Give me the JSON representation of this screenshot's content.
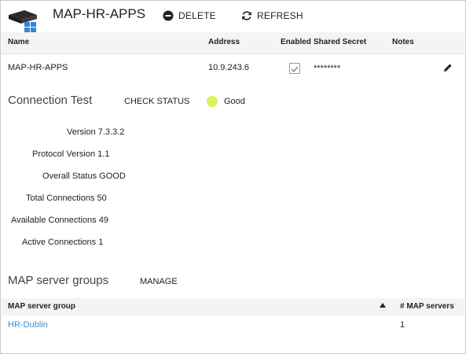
{
  "header": {
    "title": "MAP-HR-APPS",
    "delete_label": "DELETE",
    "refresh_label": "REFRESH",
    "app_icon": "server-windows-icon"
  },
  "table": {
    "columns": [
      "Name",
      "Address",
      "Enabled",
      "Shared Secret",
      "Notes"
    ],
    "row": {
      "name": "MAP-HR-APPS",
      "address": "10.9.243.6",
      "enabled": true,
      "shared_secret": "********",
      "notes": ""
    }
  },
  "connection_test": {
    "title": "Connection Test",
    "check_status_label": "CHECK STATUS",
    "status_text": "Good",
    "status_color": "#ddf05a",
    "fields": [
      {
        "label": "Version",
        "value": "7.3.3.2"
      },
      {
        "label": "Protocol Version",
        "value": "1.1"
      },
      {
        "label": "Overall Status",
        "value": "GOOD"
      },
      {
        "label": "Total Connections",
        "value": "50"
      },
      {
        "label": "Available Connections",
        "value": "49"
      },
      {
        "label": "Active Connections",
        "value": "1"
      }
    ]
  },
  "groups": {
    "title": "MAP server groups",
    "manage_label": "MANAGE",
    "columns": [
      "MAP server group",
      "# MAP servers"
    ],
    "rows": [
      {
        "name": "HR-Dublin",
        "count": "1"
      }
    ],
    "link_color": "#3b8fd6"
  }
}
